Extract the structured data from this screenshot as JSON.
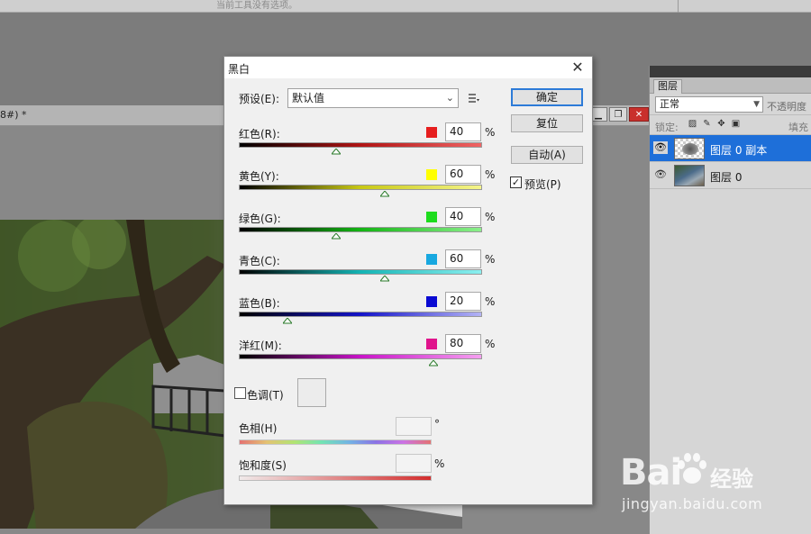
{
  "workspace": {
    "top_text": "当前工具没有选项。",
    "doc_title": "8#) *"
  },
  "dialog": {
    "title": "黑白",
    "close_glyph": "✕",
    "preset_label": "预设(E):",
    "preset_value": "默认值",
    "channels": [
      {
        "label": "红色(R):",
        "value": "40",
        "swatch": "#e61e1e",
        "track_from": "#000000",
        "track_mid": "#b01414",
        "track_to": "#f06464",
        "position": 40
      },
      {
        "label": "黄色(Y):",
        "value": "60",
        "swatch": "#ffff00",
        "track_from": "#000000",
        "track_mid": "#c8c814",
        "track_to": "#f5f58c",
        "position": 60
      },
      {
        "label": "绿色(G):",
        "value": "40",
        "swatch": "#1edc1e",
        "track_from": "#000000",
        "track_mid": "#14b414",
        "track_to": "#8cf08c",
        "position": 40
      },
      {
        "label": "青色(C):",
        "value": "60",
        "swatch": "#18a8e0",
        "track_from": "#000000",
        "track_mid": "#14b4b4",
        "track_to": "#8cf0f0",
        "position": 60
      },
      {
        "label": "蓝色(B):",
        "value": "20",
        "swatch": "#0a0ad2",
        "track_from": "#000000",
        "track_mid": "#1414c8",
        "track_to": "#b4b4f5",
        "position": 20
      },
      {
        "label": "洋红(M):",
        "value": "80",
        "swatch": "#e0148c",
        "track_from": "#000000",
        "track_mid": "#c814c8",
        "track_to": "#f5a0f0",
        "position": 80
      }
    ],
    "percent": "%",
    "tint_label": "色调(T)",
    "hue_label": "色相(H)",
    "hue_unit": "°",
    "saturation_label": "饱和度(S)",
    "saturation_unit": "%",
    "buttons": {
      "ok": "确定",
      "reset": "复位",
      "auto": "自动(A)"
    },
    "preview_label": "预览(P)",
    "preview_checked": "✓"
  },
  "layers_panel": {
    "tab": "图层",
    "blend_mode": "正常",
    "opacity_label": "不透明度",
    "lock_label": "锁定:",
    "fill_label": "填充",
    "layers": [
      {
        "name": "图层 0 副本",
        "selected": true
      },
      {
        "name": "图层 0",
        "selected": false
      }
    ]
  },
  "watermark": {
    "brand": "Bai",
    "brand_cn": "经验",
    "url": "jingyan.baidu.com"
  },
  "colors": {
    "accent_selected": "#1e6fd9",
    "ok_border": "#2d7bd8"
  }
}
